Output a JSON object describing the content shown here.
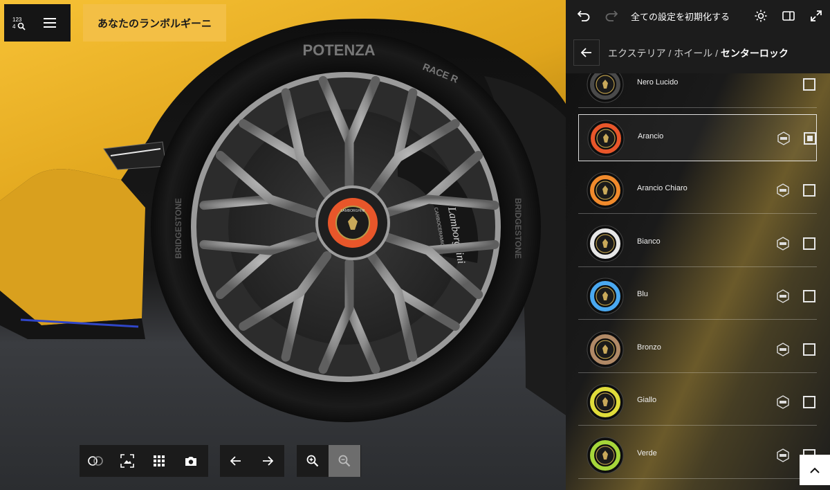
{
  "header": {
    "brand_tag": "あなたのランボルギーニ"
  },
  "viewer": {
    "caliper_text": "Lamborghini",
    "caliper_sub": "CARBOCERAMIC",
    "tire_brand": "POTENZA",
    "tire_model": "RACE R",
    "sidewall_brand": "BRIDGESTONE",
    "hub_logo": "LAMBORGHINI"
  },
  "panel": {
    "reset_label": "全ての設定を初期化する",
    "breadcrumb": {
      "parent": "エクステリア / ホイール / ",
      "current": "センターロック"
    },
    "items": [
      {
        "label": "Nero Lucido",
        "ring": "#4a4a4a",
        "selected": false,
        "has_badge": false
      },
      {
        "label": "Arancio",
        "ring": "#e8562a",
        "selected": true,
        "has_badge": true
      },
      {
        "label": "Arancio Chiaro",
        "ring": "#f08a2c",
        "selected": false,
        "has_badge": true
      },
      {
        "label": "Bianco",
        "ring": "#e6e6e6",
        "selected": false,
        "has_badge": true
      },
      {
        "label": "Blu",
        "ring": "#4aa8f0",
        "selected": false,
        "has_badge": true
      },
      {
        "label": "Bronzo",
        "ring": "#b08966",
        "selected": false,
        "has_badge": true
      },
      {
        "label": "Giallo",
        "ring": "#e0dc3a",
        "selected": false,
        "has_badge": true
      },
      {
        "label": "Verde",
        "ring": "#a6d63a",
        "selected": false,
        "has_badge": true
      }
    ]
  },
  "colors": {
    "brand_yellow": "#f3bf45",
    "panel_bg": "#1c1c1c",
    "toolbar_bg": "#1b1b1b"
  }
}
